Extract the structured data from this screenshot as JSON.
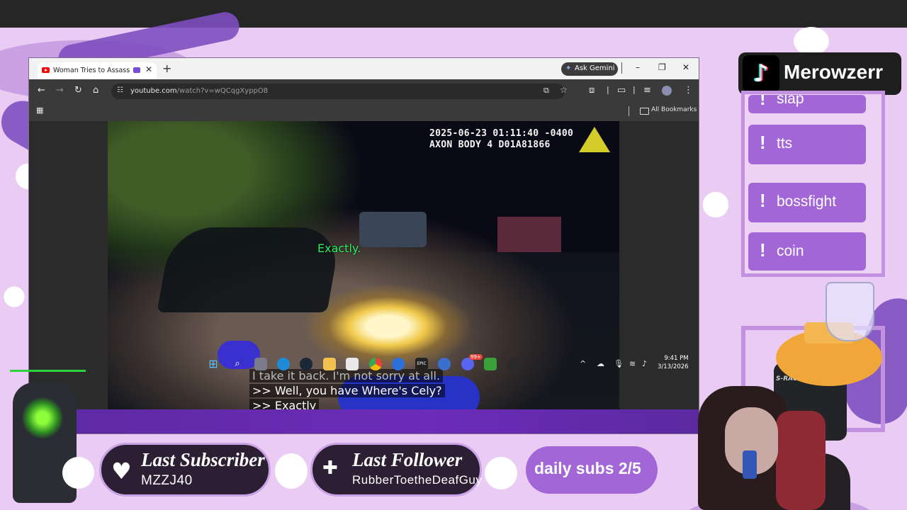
{
  "browser": {
    "tab_title": "Woman Tries to Assassinate",
    "new_tab": "+",
    "ask_gemini": "Ask Gemini",
    "url_host": "youtube.com",
    "url_path": "/watch?v=wQCqgXyppO8",
    "all_bookmarks": "All Bookmarks",
    "window_controls": [
      "–",
      "❐",
      "✕"
    ]
  },
  "video": {
    "timestamp_line1": "2025-06-23 01:11:40 -0400",
    "timestamp_line2": "AXON BODY 4 D01A81866",
    "overlay_word": "Exactly.",
    "captions": [
      "I take it back. I'm not sorry at all.",
      ">> Well, you have Where's Cely?",
      ">> Exactly"
    ]
  },
  "taskbar": {
    "time": "9:41 PM",
    "date": "3/13/2026",
    "apps": [
      "windows-start",
      "search",
      "task-view",
      "edge",
      "steam",
      "file-explorer",
      "store",
      "chrome",
      "app-blue",
      "epic-games",
      "app-globe",
      "discord",
      "minecraft",
      "obs"
    ],
    "discord_badge": "99+"
  },
  "stream": {
    "tiktok_name": "Merowzerr",
    "commands": [
      "slap",
      "tts",
      "bossfight",
      "coin"
    ],
    "last_subscriber_title": "Last Subscriber",
    "last_subscriber_name": "MZZJ40",
    "last_follower_title": "Last Follower",
    "last_follower_name": "RubberToetheDeafGuy",
    "daily_subs": "daily subs 2/5",
    "chair_brand": "S-RACER"
  },
  "colors": {
    "overlay_bg": "#eacbf3",
    "accent_purple": "#a266d6",
    "taskbar": "#6c2bb8"
  }
}
